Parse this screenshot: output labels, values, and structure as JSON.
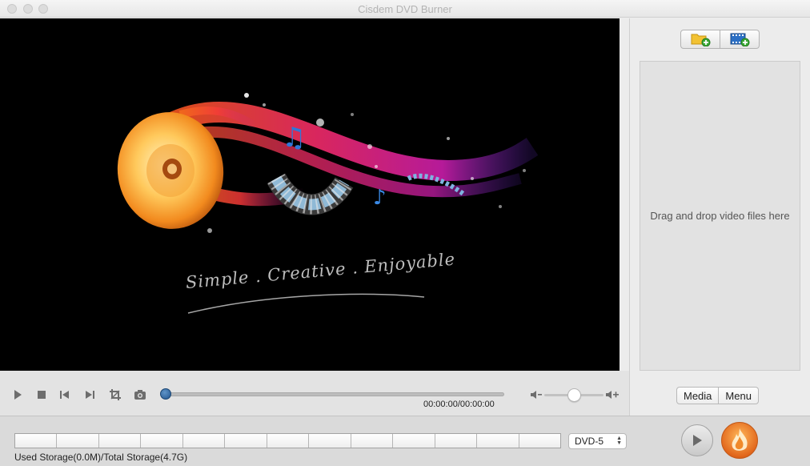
{
  "window": {
    "title": "Cisdem DVD Burner"
  },
  "preview": {
    "slogan": "Simple . Creative . Enjoyable"
  },
  "controls": {
    "timecode": "00:00:00/00:00:00",
    "progress_fraction": 0,
    "volume_fraction": 0.5
  },
  "sidebar": {
    "drop_hint": "Drag and drop video files here",
    "tabs": [
      {
        "label": "Media"
      },
      {
        "label": "Menu"
      }
    ]
  },
  "bottom": {
    "storage_label": "Used Storage(0.0M)/Total Storage(4.7G)",
    "disc_type": "DVD-5",
    "storage_segments": 13
  },
  "colors": {
    "accent": "#22558e",
    "burn": "#e2671c",
    "preview_bg": "#000000"
  },
  "icons": [
    "play-icon",
    "stop-icon",
    "previous-icon",
    "next-icon",
    "crop-icon",
    "snapshot-icon",
    "volume-down-icon",
    "volume-up-icon",
    "add-folder-icon",
    "add-video-icon",
    "preview-play-icon",
    "burn-flame-icon"
  ]
}
